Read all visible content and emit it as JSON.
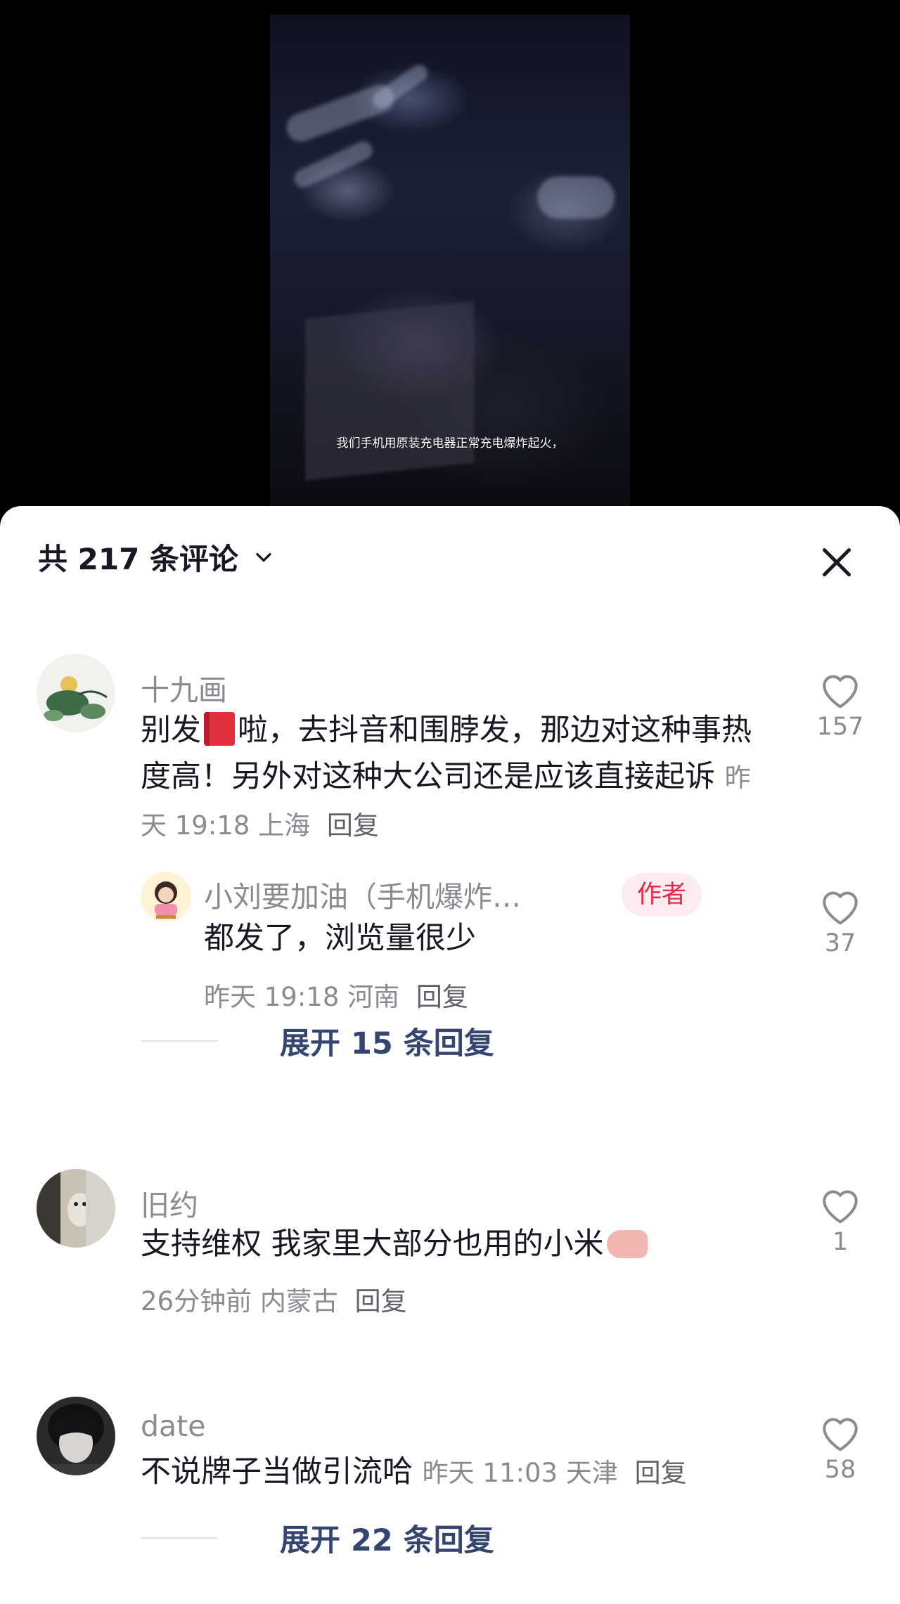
{
  "video": {
    "subtitle": "我们手机用原装充电器正常充电爆炸起火，"
  },
  "header": {
    "title": "共 217 条评论"
  },
  "comments": [
    {
      "username": "十九画",
      "text_a": "别发",
      "text_b": "啦，去抖音和围脖发，那边对这种事热度高！另外对这种大公司还是应该直接起诉",
      "time": "昨天 19:18",
      "location": "上海",
      "reply": "回复",
      "likes": "157",
      "sub_reply": {
        "username": "小刘要加油（手机爆炸…",
        "badge": "作者",
        "text": "都发了，浏览量很少",
        "time": "昨天 19:18",
        "location": "河南",
        "reply": "回复",
        "likes": "37"
      },
      "expand_label": "展开 15 条回复"
    },
    {
      "username": "旧约",
      "text": "支持维权 我家里大部分也用的小米",
      "time": "26分钟前",
      "location": "内蒙古",
      "reply": "回复",
      "likes": "1"
    },
    {
      "username": "date",
      "text": "不说牌子当做引流哈",
      "time": "昨天 11:03",
      "location": "天津",
      "reply": "回复",
      "likes": "58",
      "expand_label": "展开 22 条回复"
    }
  ],
  "icons": {
    "like": "heart-outline-icon",
    "close": "close-icon",
    "dropdown": "chevron-down-icon"
  },
  "colors": {
    "author_badge_bg": "#fdecef",
    "author_badge_text": "#e5284b",
    "expand_text": "#34456f"
  }
}
